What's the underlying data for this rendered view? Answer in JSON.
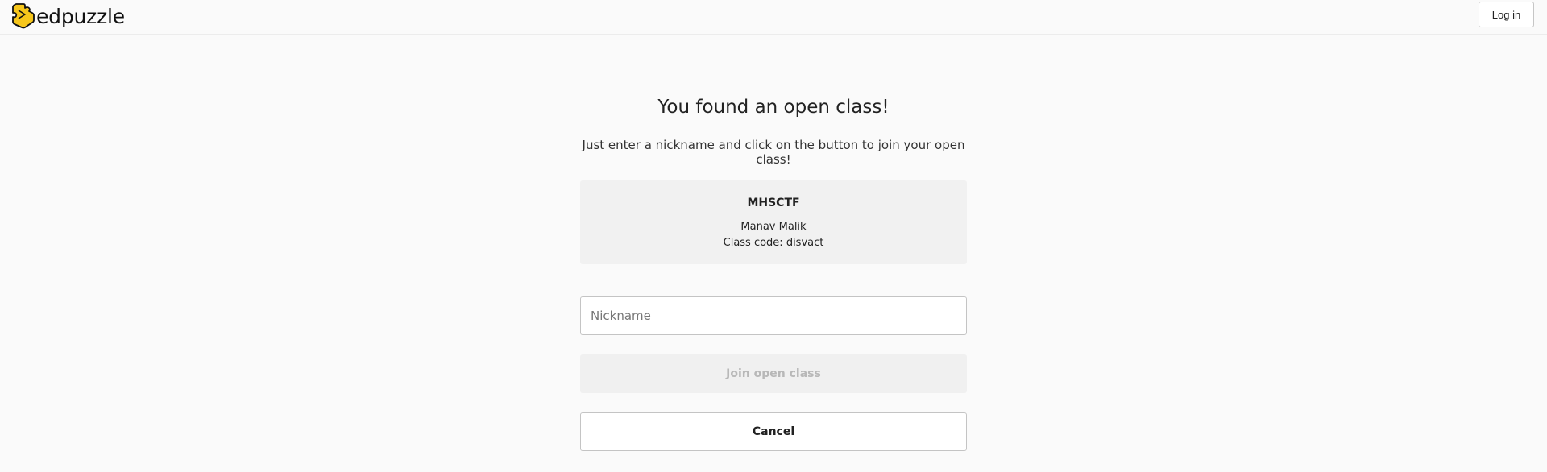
{
  "header": {
    "logo_text": "edpuzzle",
    "login_label": "Log in"
  },
  "main": {
    "title": "You found an open class!",
    "subtitle": "Just enter a nickname and click on the button to join your open class!",
    "class": {
      "name": "MHSCTF",
      "owner": "Manav Malik",
      "code_line": "Class code: disvact"
    },
    "nickname": {
      "value": "",
      "placeholder": "Nickname"
    },
    "join_label": "Join open class",
    "cancel_label": "Cancel"
  },
  "colors": {
    "logo_fill": "#f6c61b",
    "logo_outline": "#111111",
    "background": "#fafafa",
    "card_background": "#f1f1f1"
  },
  "icons": {
    "logo": "edpuzzle-puzzle-logo-icon"
  }
}
